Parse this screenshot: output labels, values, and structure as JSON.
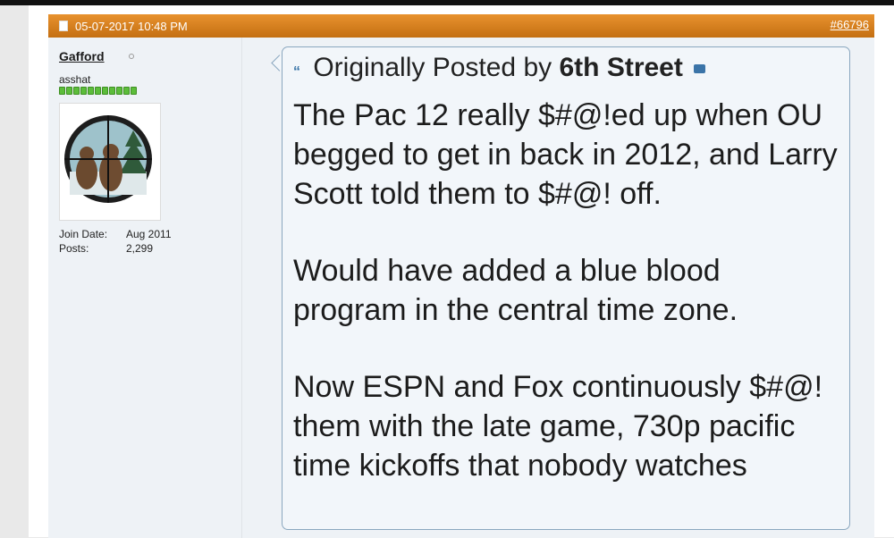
{
  "post": {
    "date": "05-07-2017 10:48 PM",
    "number": "#66796"
  },
  "user": {
    "name": "Gafford",
    "title": "asshat",
    "rep_bars": 11,
    "join_label": "Join Date:",
    "join_value": "Aug 2011",
    "posts_label": "Posts:",
    "posts_value": "2,299"
  },
  "quote": {
    "prefix": "Originally Posted by",
    "author": "6th Street",
    "paragraphs": [
      "The Pac 12 really $#@!ed up when OU begged to get in back in 2012, and Larry Scott told them to $#@! off.",
      "Would have added a blue blood program in the central time zone.",
      "Now ESPN and Fox continuously $#@! them with the late game, 730p pacific time kickoffs that nobody watches"
    ]
  },
  "colors": {
    "header": "#d8801e",
    "quote_border": "#8aa7bf",
    "rep": "#5cbd3a"
  }
}
